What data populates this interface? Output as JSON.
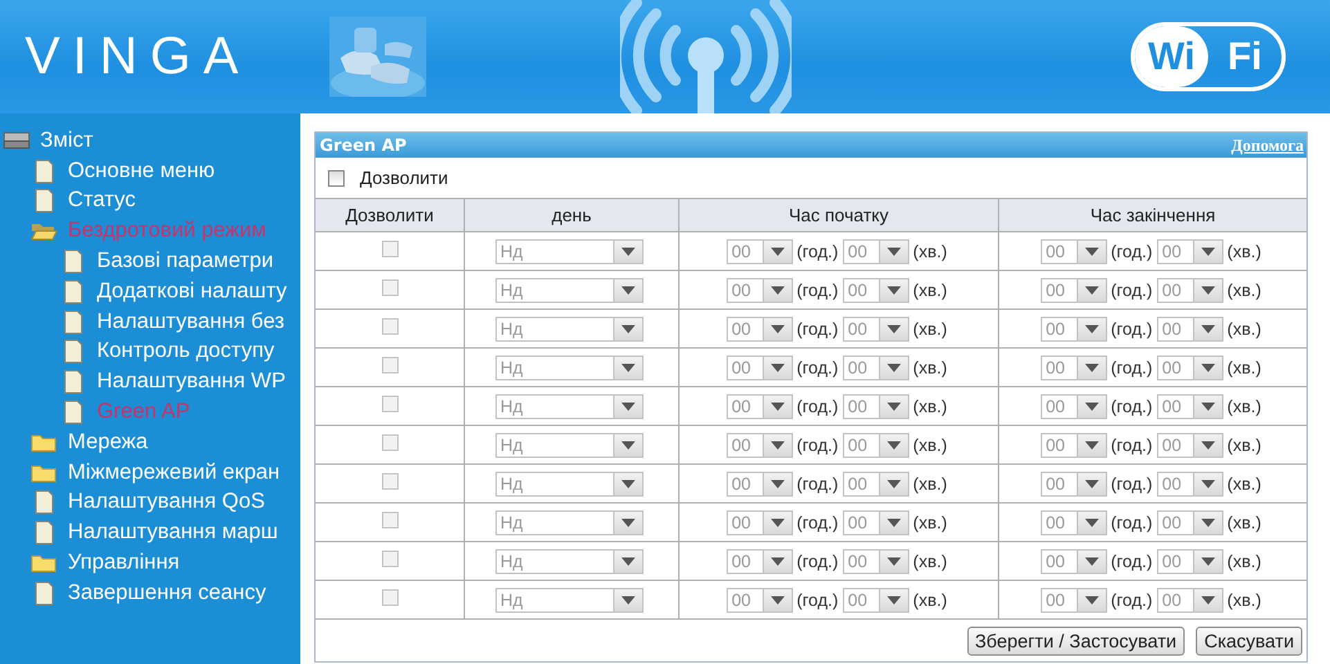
{
  "header": {
    "logo": "VINGA",
    "badge": {
      "left": "Wi",
      "right": "Fi"
    }
  },
  "sidebar": {
    "items": [
      {
        "label": "Зміст",
        "kind": "root",
        "selected": false,
        "children": [
          {
            "label": "Основне меню",
            "kind": "page",
            "selected": false
          },
          {
            "label": "Статус",
            "kind": "page",
            "selected": false
          },
          {
            "label": "Бездротовий режим",
            "kind": "folder",
            "expanded": true,
            "selected": true,
            "children": [
              {
                "label": "Базові параметри",
                "kind": "page",
                "selected": false
              },
              {
                "label": "Додаткові налашту",
                "kind": "page",
                "selected": false
              },
              {
                "label": "Налаштування без",
                "kind": "page",
                "selected": false
              },
              {
                "label": "Контроль доступу",
                "kind": "page",
                "selected": false
              },
              {
                "label": "Налаштування WP",
                "kind": "page",
                "selected": false
              },
              {
                "label": "Green AP",
                "kind": "page",
                "selected": true
              }
            ]
          },
          {
            "label": "Мережа",
            "kind": "folder",
            "expanded": false,
            "selected": false
          },
          {
            "label": "Міжмережевий екран",
            "kind": "folder",
            "expanded": false,
            "selected": false
          },
          {
            "label": "Налаштування QoS",
            "kind": "page",
            "selected": false
          },
          {
            "label": "Налаштування марш",
            "kind": "page",
            "selected": false
          },
          {
            "label": "Управління",
            "kind": "folder",
            "expanded": false,
            "selected": false
          },
          {
            "label": "Завершення сеансу",
            "kind": "page",
            "selected": false
          }
        ]
      }
    ]
  },
  "panel": {
    "title": "Green AP",
    "help_link": "Допомога",
    "enable": {
      "label": "Дозволити",
      "checked": false
    },
    "table": {
      "columns": [
        "Дозволити",
        "день",
        "Час початку",
        "Час закінчення"
      ],
      "rows": [
        {
          "enabled": false,
          "disabled": true,
          "day": "Нд",
          "start_hour": "00",
          "start_hour_unit": "(год.)",
          "start_minute": "00",
          "start_minute_unit": "(хв.)",
          "end_hour": "00",
          "end_hour_unit": "(год.)",
          "end_minute": "00",
          "end_minute_unit": "(хв.)"
        },
        {
          "enabled": false,
          "disabled": true,
          "day": "Нд",
          "start_hour": "00",
          "start_hour_unit": "(год.)",
          "start_minute": "00",
          "start_minute_unit": "(хв.)",
          "end_hour": "00",
          "end_hour_unit": "(год.)",
          "end_minute": "00",
          "end_minute_unit": "(хв.)"
        },
        {
          "enabled": false,
          "disabled": true,
          "day": "Нд",
          "start_hour": "00",
          "start_hour_unit": "(год.)",
          "start_minute": "00",
          "start_minute_unit": "(хв.)",
          "end_hour": "00",
          "end_hour_unit": "(год.)",
          "end_minute": "00",
          "end_minute_unit": "(хв.)"
        },
        {
          "enabled": false,
          "disabled": true,
          "day": "Нд",
          "start_hour": "00",
          "start_hour_unit": "(год.)",
          "start_minute": "00",
          "start_minute_unit": "(хв.)",
          "end_hour": "00",
          "end_hour_unit": "(год.)",
          "end_minute": "00",
          "end_minute_unit": "(хв.)"
        },
        {
          "enabled": false,
          "disabled": true,
          "day": "Нд",
          "start_hour": "00",
          "start_hour_unit": "(год.)",
          "start_minute": "00",
          "start_minute_unit": "(хв.)",
          "end_hour": "00",
          "end_hour_unit": "(год.)",
          "end_minute": "00",
          "end_minute_unit": "(хв.)"
        },
        {
          "enabled": false,
          "disabled": true,
          "day": "Нд",
          "start_hour": "00",
          "start_hour_unit": "(год.)",
          "start_minute": "00",
          "start_minute_unit": "(хв.)",
          "end_hour": "00",
          "end_hour_unit": "(год.)",
          "end_minute": "00",
          "end_minute_unit": "(хв.)"
        },
        {
          "enabled": false,
          "disabled": true,
          "day": "Нд",
          "start_hour": "00",
          "start_hour_unit": "(год.)",
          "start_minute": "00",
          "start_minute_unit": "(хв.)",
          "end_hour": "00",
          "end_hour_unit": "(год.)",
          "end_minute": "00",
          "end_minute_unit": "(хв.)"
        },
        {
          "enabled": false,
          "disabled": true,
          "day": "Нд",
          "start_hour": "00",
          "start_hour_unit": "(год.)",
          "start_minute": "00",
          "start_minute_unit": "(хв.)",
          "end_hour": "00",
          "end_hour_unit": "(год.)",
          "end_minute": "00",
          "end_minute_unit": "(хв.)"
        },
        {
          "enabled": false,
          "disabled": true,
          "day": "Нд",
          "start_hour": "00",
          "start_hour_unit": "(год.)",
          "start_minute": "00",
          "start_minute_unit": "(хв.)",
          "end_hour": "00",
          "end_hour_unit": "(год.)",
          "end_minute": "00",
          "end_minute_unit": "(хв.)"
        },
        {
          "enabled": false,
          "disabled": true,
          "day": "Нд",
          "start_hour": "00",
          "start_hour_unit": "(год.)",
          "start_minute": "00",
          "start_minute_unit": "(хв.)",
          "end_hour": "00",
          "end_hour_unit": "(год.)",
          "end_minute": "00",
          "end_minute_unit": "(хв.)"
        }
      ]
    },
    "buttons": [
      "Зберегти / Застосувати",
      "Скасувати"
    ]
  }
}
